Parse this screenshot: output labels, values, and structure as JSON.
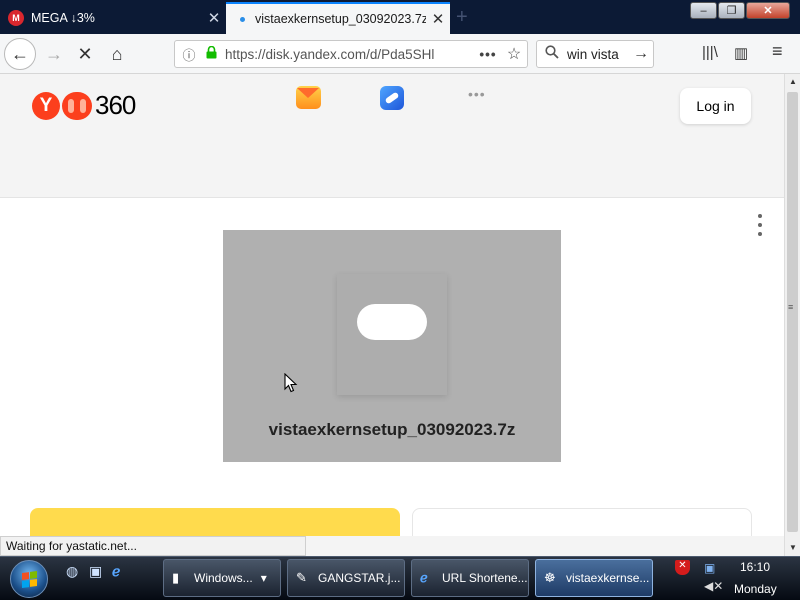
{
  "browser": {
    "tabs": [
      {
        "label": "MEGA ↓3%",
        "icon": "mega-logo",
        "logo_letter": "M",
        "active": false
      },
      {
        "label": "vistaexkernsetup_03092023.7z –",
        "icon": "loading-dot",
        "active": true
      }
    ],
    "new_tab_symbol": "+",
    "close_symbol": "✕",
    "window_controls": {
      "minimize": "–",
      "maximize": "❐",
      "close": "✕"
    },
    "nav": {
      "back": "←",
      "forward": "→",
      "stop": "✕",
      "home": "⌂"
    },
    "url": {
      "info_symbol": "ⓘ",
      "lock_symbol": "🔒",
      "value": "https://disk.yandex.com/d/Pda5SHl",
      "more_symbol": "•••",
      "star_symbol": "☆"
    },
    "search": {
      "icon_symbol": "⚲",
      "value": "win vista",
      "go_symbol": "→"
    },
    "toolbar": {
      "library_symbol": "|||\\",
      "sidebar_symbol": "▥",
      "menu_symbol": "≡"
    },
    "status": "Waiting for yastatic.net..."
  },
  "page": {
    "logo_text": "360",
    "logo_letter": "Y",
    "services_more": "•••",
    "login_label": "Log in",
    "file_name": "vistaexkernsetup_03092023.7z"
  },
  "scrollbar": {
    "up": "▲",
    "down": "▼",
    "grip": "≡"
  },
  "taskbar": {
    "quick_launch": [
      "◍",
      "▣",
      "ℯ"
    ],
    "buttons": [
      {
        "label": "Windows...",
        "icon": "▮",
        "active": false,
        "dropdown": "▾"
      },
      {
        "label": "GANGSTAR.j...",
        "icon": "✎",
        "active": false
      },
      {
        "label": "URL Shortene...",
        "icon": "ℯ",
        "active": false
      },
      {
        "label": "vistaexkernse...",
        "icon": "☸",
        "active": true
      }
    ],
    "tray": {
      "security_symbol": "✕",
      "network_symbol": "▣",
      "volume_symbol": "◀✕"
    },
    "clock": {
      "time": "16:10",
      "day": "Monday"
    }
  },
  "colors": {
    "tabstrip": "#0c1a35",
    "accent_blue": "#0a84ff",
    "yandex_red": "#fc3f1d",
    "download_yellow": "#ffdb4d",
    "preview_gray": "#b0b0b0"
  }
}
